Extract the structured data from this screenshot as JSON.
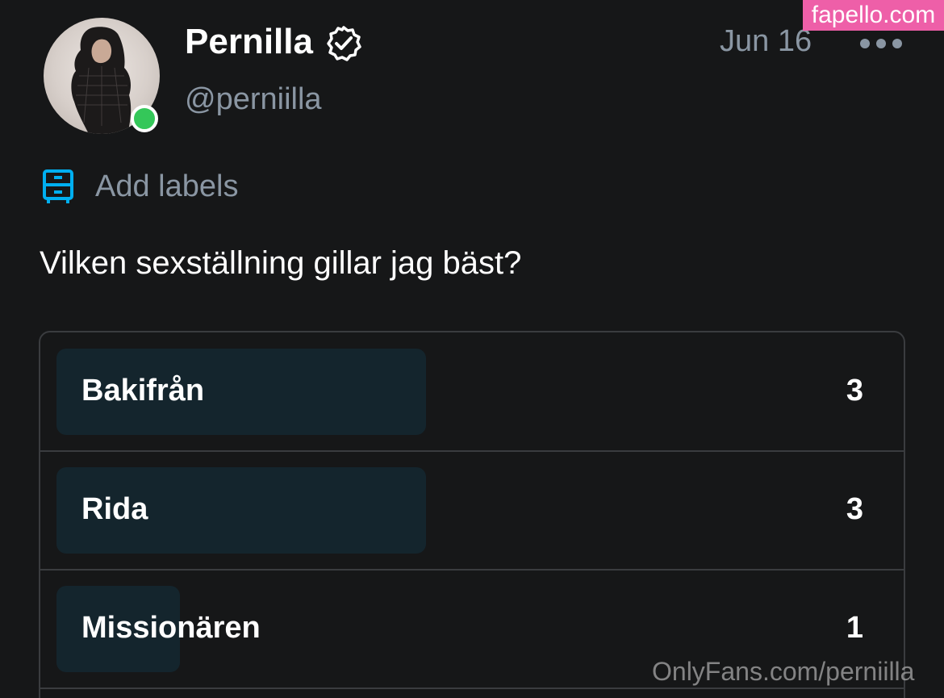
{
  "header": {
    "display_name": "Pernilla",
    "username": "@perniilla",
    "date": "Jun 16",
    "online_color": "#34c759",
    "verified_icon": "verified-badge-icon",
    "more_icon": "more-horizontal-icon"
  },
  "labels": {
    "icon": "labels-drawer-icon",
    "text": "Add labels",
    "icon_color": "#00aff0"
  },
  "post": {
    "text": "Vilken sexställning gillar jag bäst?"
  },
  "poll": {
    "bar_color": "#14252d",
    "options": [
      {
        "label": "Bakifrån",
        "count": "3",
        "share": 0.43
      },
      {
        "label": "Rida",
        "count": "3",
        "share": 0.43
      },
      {
        "label": "Missionären",
        "count": "1",
        "share": 0.14
      }
    ]
  },
  "watermarks": {
    "top": "fapello.com",
    "top_color": "#ee5fa8",
    "bottom": "OnlyFans.com/perniilla"
  }
}
